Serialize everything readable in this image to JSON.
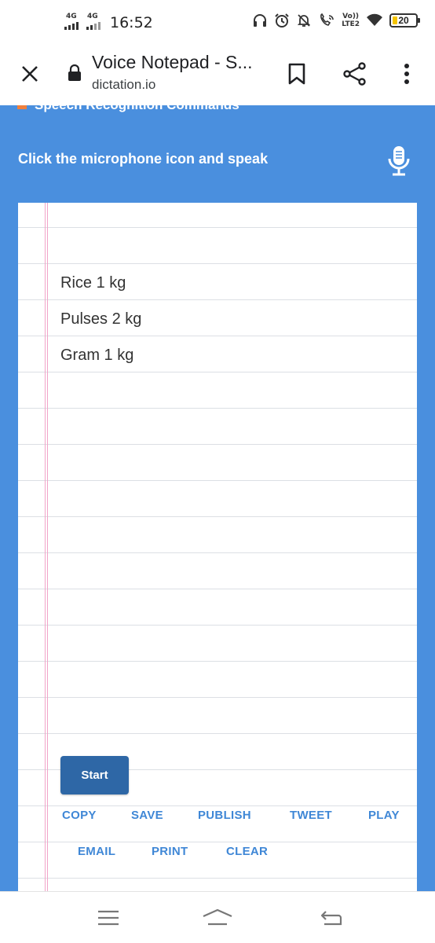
{
  "status": {
    "sim1": "4G",
    "sim2": "4G",
    "time": "16:52",
    "volte": "Vo))",
    "lte": "LTE2",
    "battery": "20"
  },
  "browser": {
    "title": "Voice Notepad - S...",
    "url": "dictation.io"
  },
  "page": {
    "cut_header": "Speech Recognition Commands",
    "instruction": "Click the microphone icon and speak",
    "note_lines": [
      "Rice 1 kg",
      "Pulses 2 kg",
      "Gram 1 kg"
    ],
    "start_label": "Start",
    "actions_row1": [
      "COPY",
      "SAVE",
      "PUBLISH",
      "TWEET",
      "PLAY"
    ],
    "actions_row2": [
      "EMAIL",
      "PRINT",
      "CLEAR"
    ]
  },
  "colors": {
    "page_bg": "#4a8fde",
    "start_button": "#2e67a6",
    "action_link": "#3f87d6",
    "margin_line": "#f1a4c8"
  },
  "icons": {
    "toolbar": [
      "close-icon",
      "lock-icon",
      "bookmark-icon",
      "share-icon",
      "more-options-icon"
    ],
    "page": [
      "microphone-icon"
    ],
    "navbar": [
      "menu-icon",
      "home-icon",
      "back-icon"
    ]
  }
}
